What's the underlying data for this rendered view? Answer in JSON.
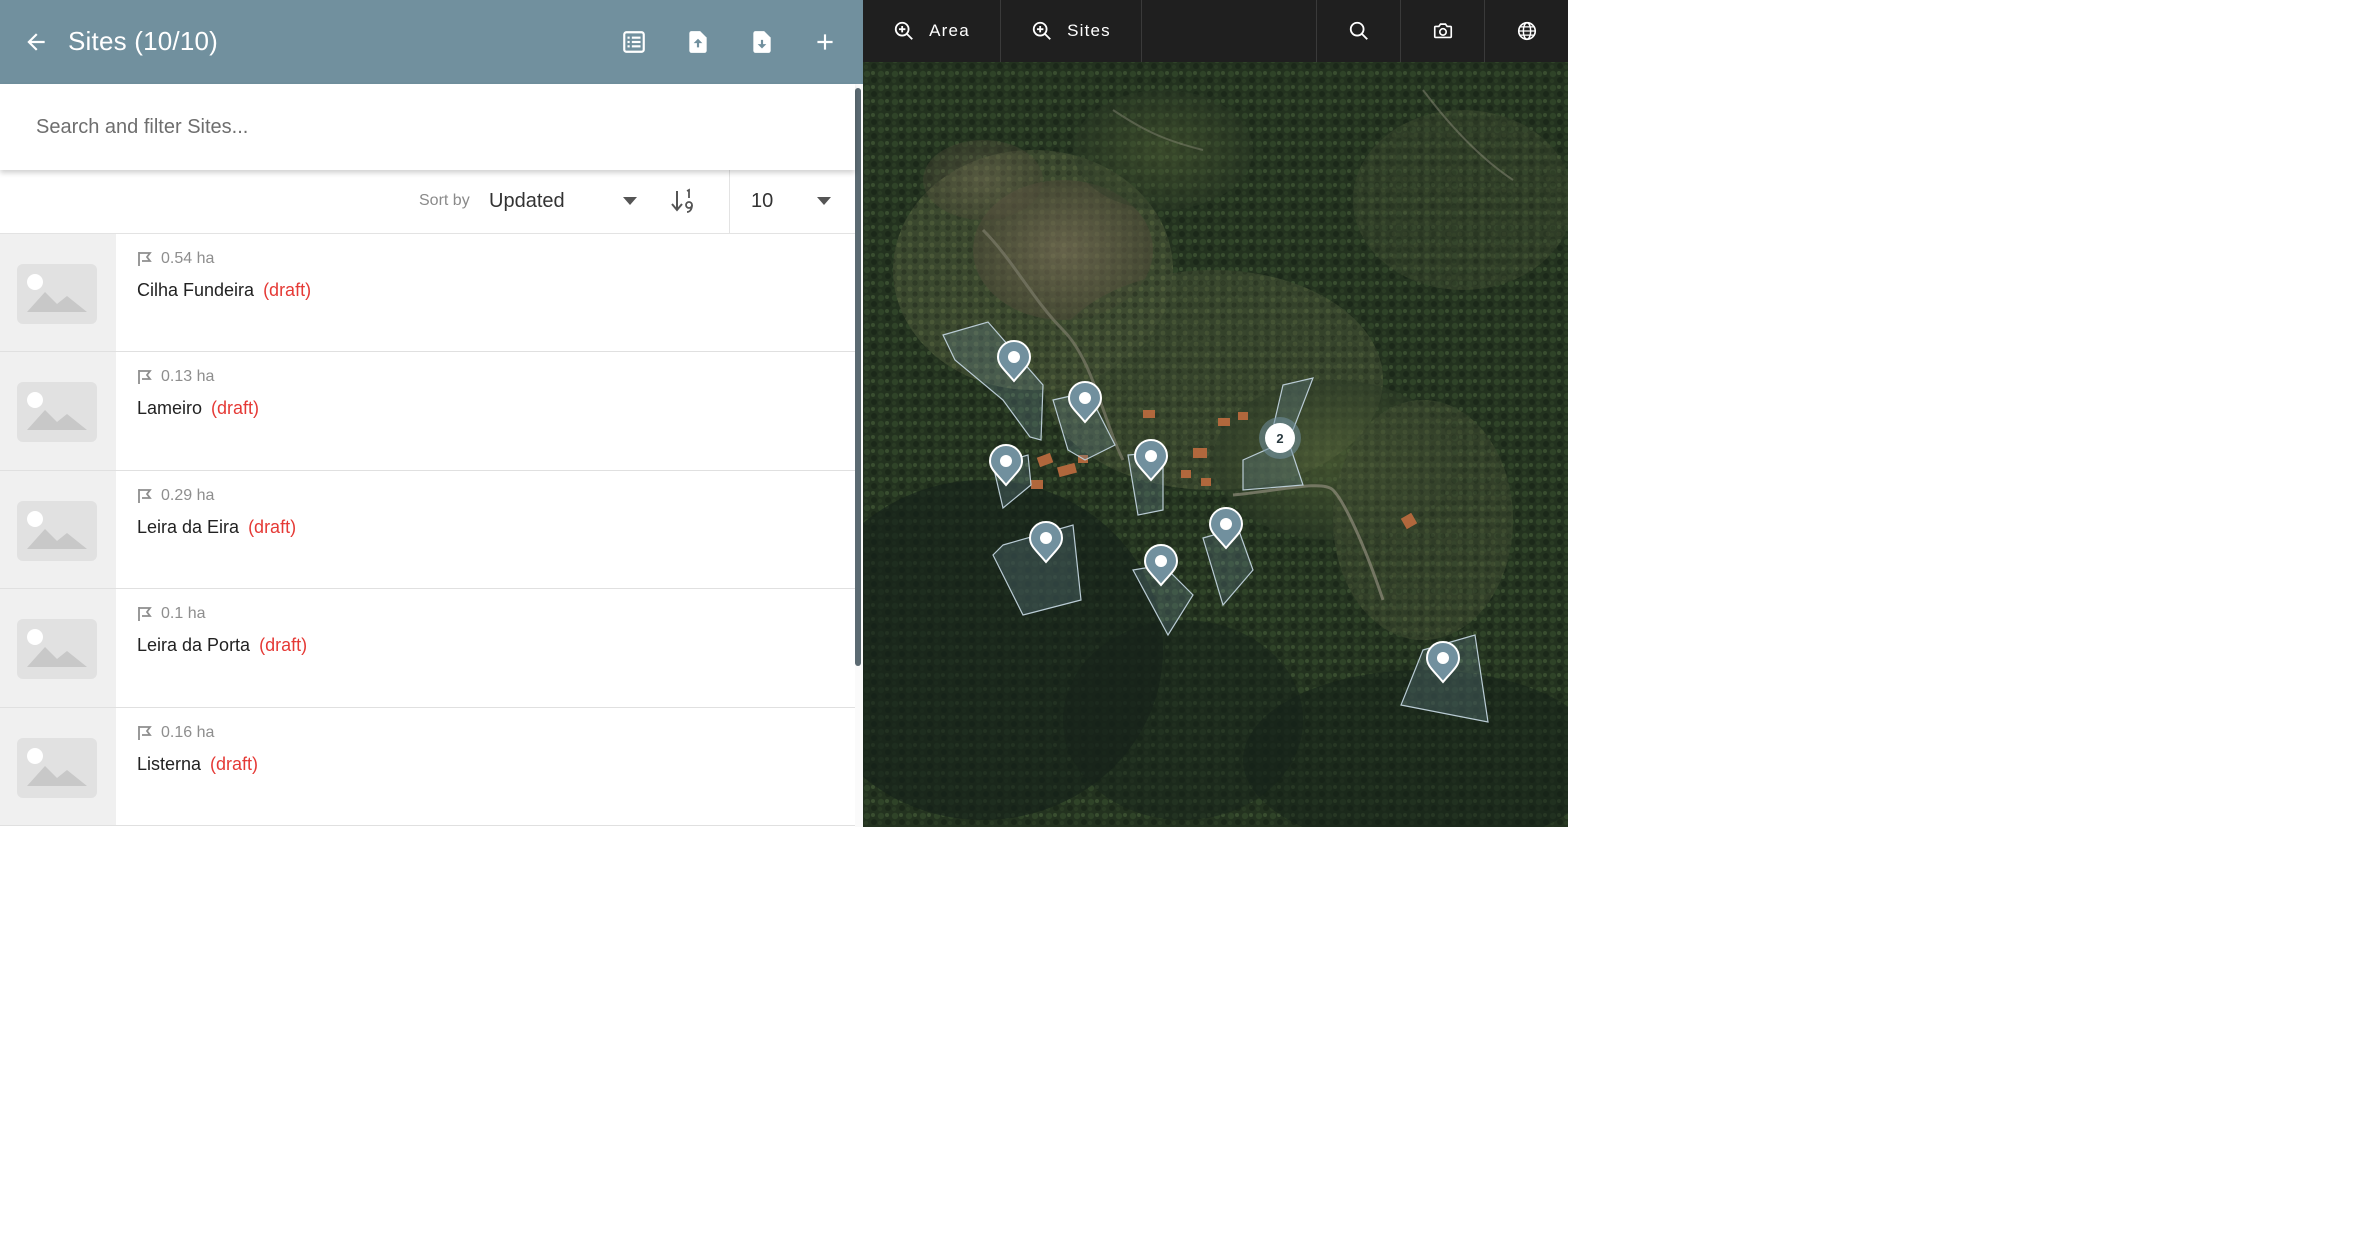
{
  "header": {
    "title": "Sites (10/10)",
    "back_icon": "arrow-left-icon",
    "actions": [
      {
        "name": "list-view-button",
        "icon": "checklist-icon"
      },
      {
        "name": "upload-button",
        "icon": "file-upload-icon"
      },
      {
        "name": "download-button",
        "icon": "file-download-icon"
      },
      {
        "name": "add-site-button",
        "icon": "plus-icon"
      }
    ],
    "background": "#71909e"
  },
  "search": {
    "placeholder": "Search and filter Sites...",
    "value": ""
  },
  "sort": {
    "label": "Sort by",
    "selected": "Updated",
    "direction_icon": "sort-numeric-descending-icon",
    "page_size": "10"
  },
  "sites": [
    {
      "area": "0.54 ha",
      "name": "Cilha Fundeira",
      "status": "(draft)"
    },
    {
      "area": "0.13 ha",
      "name": "Lameiro",
      "status": "(draft)"
    },
    {
      "area": "0.29 ha",
      "name": "Leira da Eira",
      "status": "(draft)"
    },
    {
      "area": "0.1 ha",
      "name": "Leira da Porta",
      "status": "(draft)"
    },
    {
      "area": "0.16 ha",
      "name": "Listerna",
      "status": "(draft)"
    }
  ],
  "map": {
    "toolbar": {
      "zoom_area_label": "Area",
      "zoom_sites_label": "Sites",
      "icons": [
        "zoom-in-icon",
        "search-icon",
        "camera-icon",
        "globe-icon"
      ]
    },
    "cluster_count": "2",
    "pin_count": 8
  },
  "colors": {
    "accent": "#71909e",
    "draft": "#e53935",
    "pin": "#71909e",
    "map_toolbar": "#1f1f1f"
  }
}
